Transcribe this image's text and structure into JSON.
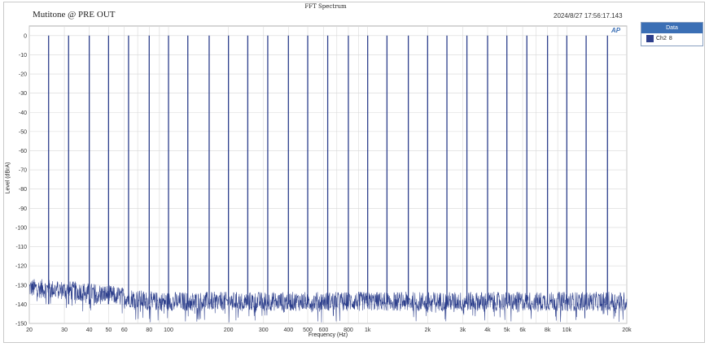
{
  "window": {
    "chart_title": "FFT Spectrum",
    "subtitle": "Mutitone @ PRE OUT",
    "timestamp": "2024/8/27 17:56:17.143",
    "logo": "AP"
  },
  "legend": {
    "header": "Data",
    "items": [
      {
        "label": "Ch2",
        "marker": "8",
        "color": "#2d3f8c"
      }
    ]
  },
  "chart_data": {
    "type": "line",
    "title": "FFT Spectrum",
    "xlabel": "Frequency (Hz)",
    "ylabel": "Level (dBrA)",
    "x_scale": "log",
    "xlim": [
      20,
      20000
    ],
    "ylim": [
      -150,
      5
    ],
    "grid": true,
    "legend_position": "right",
    "y_ticks": [
      0,
      -10,
      -20,
      -30,
      -40,
      -50,
      -60,
      -70,
      -80,
      -90,
      -100,
      -110,
      -120,
      -130,
      -140,
      -150
    ],
    "x_ticks": [
      {
        "v": 20,
        "label": "20"
      },
      {
        "v": 30,
        "label": "30"
      },
      {
        "v": 40,
        "label": "40"
      },
      {
        "v": 50,
        "label": "50"
      },
      {
        "v": 60,
        "label": "60"
      },
      {
        "v": 80,
        "label": "80"
      },
      {
        "v": 100,
        "label": "100"
      },
      {
        "v": 200,
        "label": "200"
      },
      {
        "v": 300,
        "label": "300"
      },
      {
        "v": 400,
        "label": "400"
      },
      {
        "v": 500,
        "label": "500"
      },
      {
        "v": 600,
        "label": "600"
      },
      {
        "v": 800,
        "label": "800"
      },
      {
        "v": 1000,
        "label": "1k"
      },
      {
        "v": 2000,
        "label": "2k"
      },
      {
        "v": 3000,
        "label": "3k"
      },
      {
        "v": 4000,
        "label": "4k"
      },
      {
        "v": 5000,
        "label": "5k"
      },
      {
        "v": 6000,
        "label": "6k"
      },
      {
        "v": 8000,
        "label": "8k"
      },
      {
        "v": 10000,
        "label": "10k"
      },
      {
        "v": 20000,
        "label": "20k"
      }
    ],
    "series": [
      {
        "name": "Ch2",
        "color": "#2d3f8c",
        "noise_floor_db": -140,
        "tones_hz": [
          25,
          31.5,
          40,
          50,
          63,
          80,
          100,
          125,
          160,
          200,
          250,
          315,
          400,
          500,
          630,
          800,
          1000,
          1250,
          1600,
          2000,
          2500,
          3150,
          4000,
          5000,
          6300,
          8000,
          10000,
          12500,
          16000
        ],
        "tone_level_db": 0
      }
    ]
  }
}
